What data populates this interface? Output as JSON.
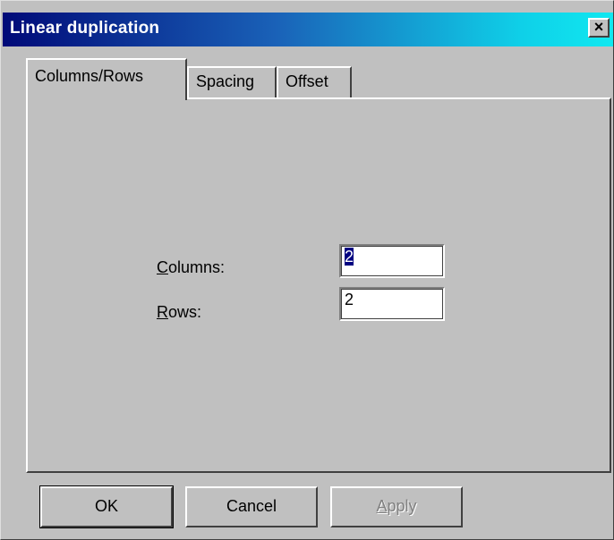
{
  "window": {
    "title": "Linear duplication",
    "close_glyph": "✕"
  },
  "tabs": [
    {
      "label": "Columns/Rows",
      "active": true
    },
    {
      "label": "Spacing",
      "active": false
    },
    {
      "label": "Offset",
      "active": false
    }
  ],
  "fields": {
    "columns": {
      "label": "Columns:",
      "value": "2"
    },
    "rows": {
      "label": "Rows:",
      "value": "2"
    }
  },
  "buttons": {
    "ok": "OK",
    "cancel": "Cancel",
    "apply": "Apply"
  },
  "colors": {
    "title_gradient_start": "#000a78",
    "title_gradient_end": "#10e8f0",
    "face": "#c0c0c0",
    "selection": "#000080"
  }
}
